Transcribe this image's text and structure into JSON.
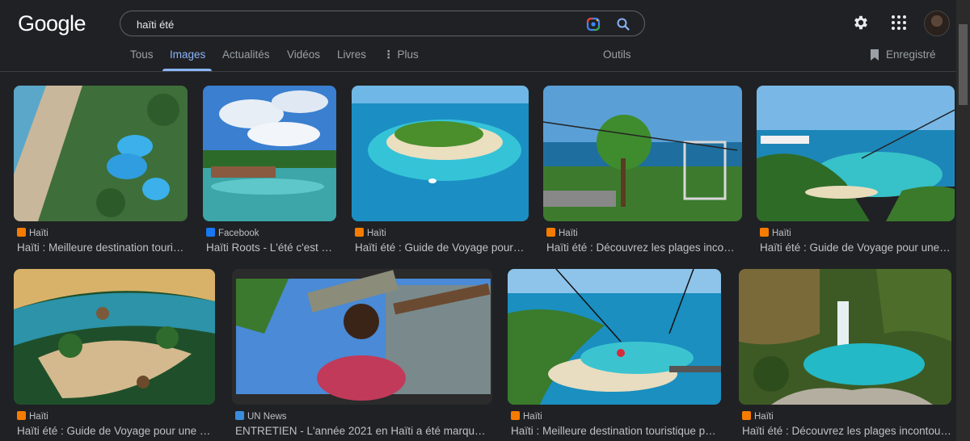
{
  "header": {
    "logo": "Google",
    "search_value": "haïti été",
    "icons": [
      "google-lens-icon",
      "search-icon",
      "gear-icon",
      "apps-grid-icon",
      "avatar"
    ]
  },
  "tabs": [
    {
      "label": "Tous"
    },
    {
      "label": "Images",
      "active": true
    },
    {
      "label": "Actualités"
    },
    {
      "label": "Vidéos"
    },
    {
      "label": "Livres"
    },
    {
      "label": "Plus"
    }
  ],
  "tools_label": "Outils",
  "saved_label": "Enregistré",
  "results": [
    {
      "source": "Haïti",
      "title": "Haïti : Meilleure destination touri…"
    },
    {
      "source": "Facebook",
      "title": "Haïti Roots - L'été c'est …"
    },
    {
      "source": "Haïti",
      "title": "Haïti été : Guide de Voyage pour…"
    },
    {
      "source": "Haïti",
      "title": "Haïti été : Découvrez les plages inco…"
    },
    {
      "source": "Haïti",
      "title": "Haïti été : Guide de Voyage pour une…"
    },
    {
      "source": "Haïti",
      "title": "Haïti été : Guide de Voyage pour une …"
    },
    {
      "source": "UN News",
      "title": "ENTRETIEN - L'année 2021 en Haïti a été marqu…"
    },
    {
      "source": "Haïti",
      "title": "Haïti : Meilleure destination touristique p…"
    },
    {
      "source": "Haïti",
      "title": "Haïti été : Découvrez les plages incontou…"
    }
  ],
  "colors": {
    "background": "#202124",
    "accent": "#8ab4f8",
    "text": "#bdc1c6"
  }
}
